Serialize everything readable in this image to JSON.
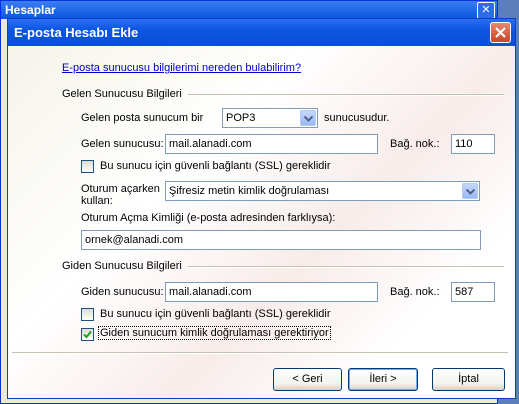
{
  "background_window": {
    "title": "Hesaplar"
  },
  "dialog": {
    "title": "E-posta Hesabı Ekle",
    "help_link": "E-posta sunucusu bilgilerimi nereden bulabilirim?",
    "incoming": {
      "group_label": "Gelen Sunucusu Bilgileri",
      "server_type_prefix": "Gelen posta sunucum bir",
      "server_type_value": "POP3",
      "server_type_suffix": "sunucusudur.",
      "server_label": "Gelen sunucusu:",
      "server_value": "mail.alanadi.com",
      "port_label": "Bağ. nok.:",
      "port_value": "110",
      "ssl_label": "Bu sunucu için güvenli bağlantı (SSL) gereklidir",
      "ssl_checked": false,
      "logon_label_line1": "Oturum açarken",
      "logon_label_line2": "kullan:",
      "logon_value": "Şifresiz metin kimlik doğrulaması",
      "login_id_label": "Oturum Açma Kimliği (e-posta adresinden farklıysa):",
      "login_id_value": "ornek@alanadi.com"
    },
    "outgoing": {
      "group_label": "Giden Sunucusu Bilgileri",
      "server_label": "Giden sunucusu:",
      "server_value": "mail.alanadi.com",
      "port_label": "Bağ. nok.:",
      "port_value": "587",
      "ssl_label": "Bu sunucu için güvenli bağlantı (SSL) gereklidir",
      "ssl_checked": false,
      "auth_label": "Giden sunucum kimlik doğrulaması gerektiriyor",
      "auth_checked": true
    },
    "buttons": {
      "back": "< Geri",
      "next": "İleri >",
      "cancel": "İptal"
    }
  }
}
